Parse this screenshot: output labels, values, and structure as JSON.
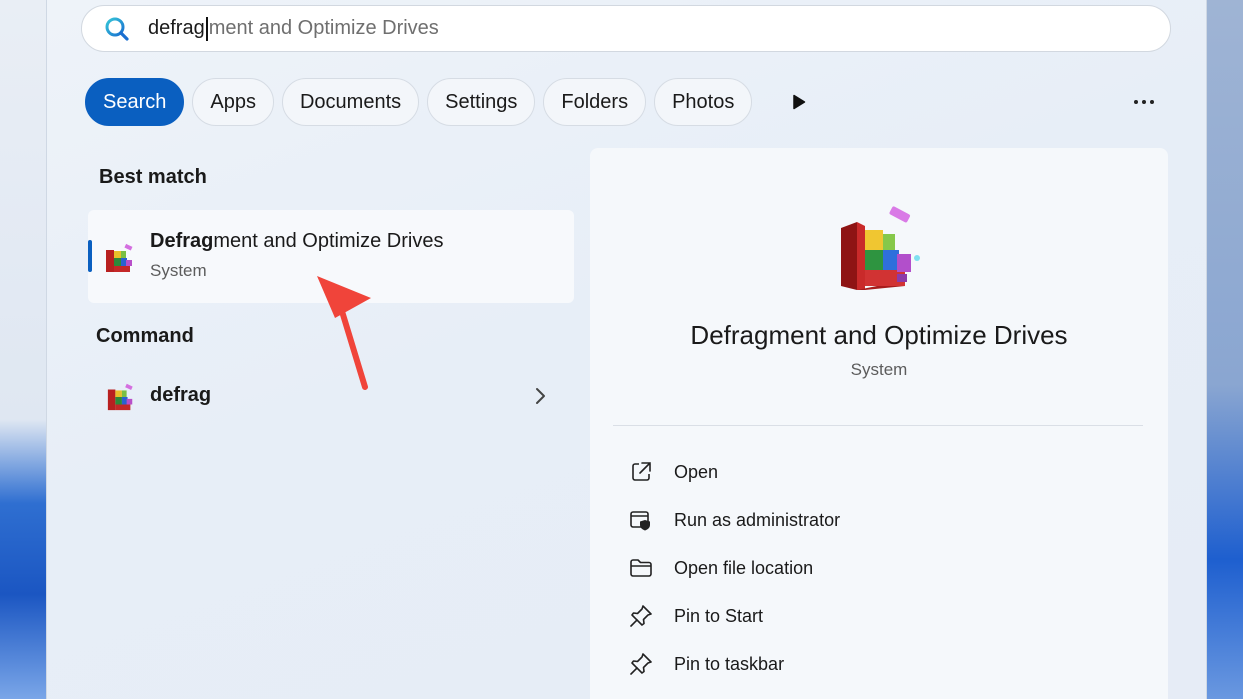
{
  "search": {
    "typed": "defrag",
    "suggestion": "ment and Optimize Drives"
  },
  "filters": [
    {
      "label": "Search",
      "active": true
    },
    {
      "label": "Apps",
      "active": false
    },
    {
      "label": "Documents",
      "active": false
    },
    {
      "label": "Settings",
      "active": false
    },
    {
      "label": "Folders",
      "active": false
    },
    {
      "label": "Photos",
      "active": false
    }
  ],
  "best_match": {
    "heading": "Best match",
    "name_bold": "Defrag",
    "name_rest": "ment and Optimize Drives",
    "subtitle": "System"
  },
  "command": {
    "heading": "Command",
    "name": "defrag"
  },
  "detail": {
    "title": "Defragment and Optimize Drives",
    "subtitle": "System",
    "actions": [
      {
        "label": "Open",
        "icon": "open-external-icon"
      },
      {
        "label": "Run as administrator",
        "icon": "shield-admin-icon"
      },
      {
        "label": "Open file location",
        "icon": "folder-icon"
      },
      {
        "label": "Pin to Start",
        "icon": "pin-icon"
      },
      {
        "label": "Pin to taskbar",
        "icon": "pin-icon"
      }
    ]
  },
  "colors": {
    "accent": "#0a5fc0",
    "annotation_arrow": "#f0443a"
  }
}
